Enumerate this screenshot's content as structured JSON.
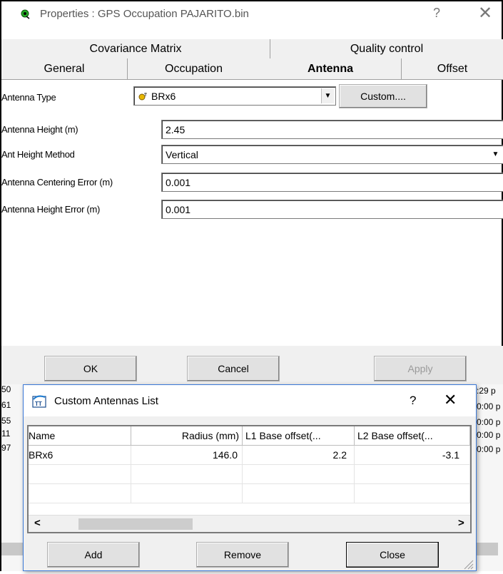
{
  "window": {
    "title": "Properties : GPS Occupation PAJARITO.bin",
    "help_glyph": "?",
    "close_glyph": "✕"
  },
  "tabs_row1": [
    {
      "label": "Covariance Matrix"
    },
    {
      "label": "Quality control"
    }
  ],
  "tabs_row2": [
    {
      "label": "General"
    },
    {
      "label": "Occupation"
    },
    {
      "label": "Antenna",
      "active": true
    },
    {
      "label": "Offset"
    }
  ],
  "antenna": {
    "type_label": "Antenna Type",
    "type_value": "BRx6",
    "custom_button": "Custom....",
    "height_label": "Antenna Height (m)",
    "height_value": "2.45",
    "method_label": "Ant Height Method",
    "method_value": "Vertical",
    "centering_label": "Antenna Centering Error (m)",
    "centering_value": "0.001",
    "height_error_label": "Antenna Height Error (m)",
    "height_error_value": "0.001"
  },
  "buttons": {
    "ok": "OK",
    "cancel": "Cancel",
    "apply": "Apply"
  },
  "background_fragments": {
    "left": [
      "50",
      "61",
      "55",
      "11",
      "97"
    ],
    "right": [
      ":29 p",
      "0:00 p",
      "0:00 p",
      "0:00 p",
      "0:00 p"
    ]
  },
  "custom_dialog": {
    "title": "Custom Antennas List",
    "help_glyph": "?",
    "close_glyph": "✕",
    "columns": [
      "Name",
      "Radius (mm)",
      "L1 Base offset(...",
      "L2 Base offset(..."
    ],
    "rows": [
      [
        "BRx6",
        "146.0",
        "2.2",
        "-3.1"
      ]
    ],
    "scroll_left": "<",
    "scroll_right": ">",
    "add_button": "Add",
    "remove_button": "Remove",
    "close_button": "Close"
  },
  "colors": {
    "accent_border": "#3a78d7",
    "face": "#f0f0f0"
  }
}
